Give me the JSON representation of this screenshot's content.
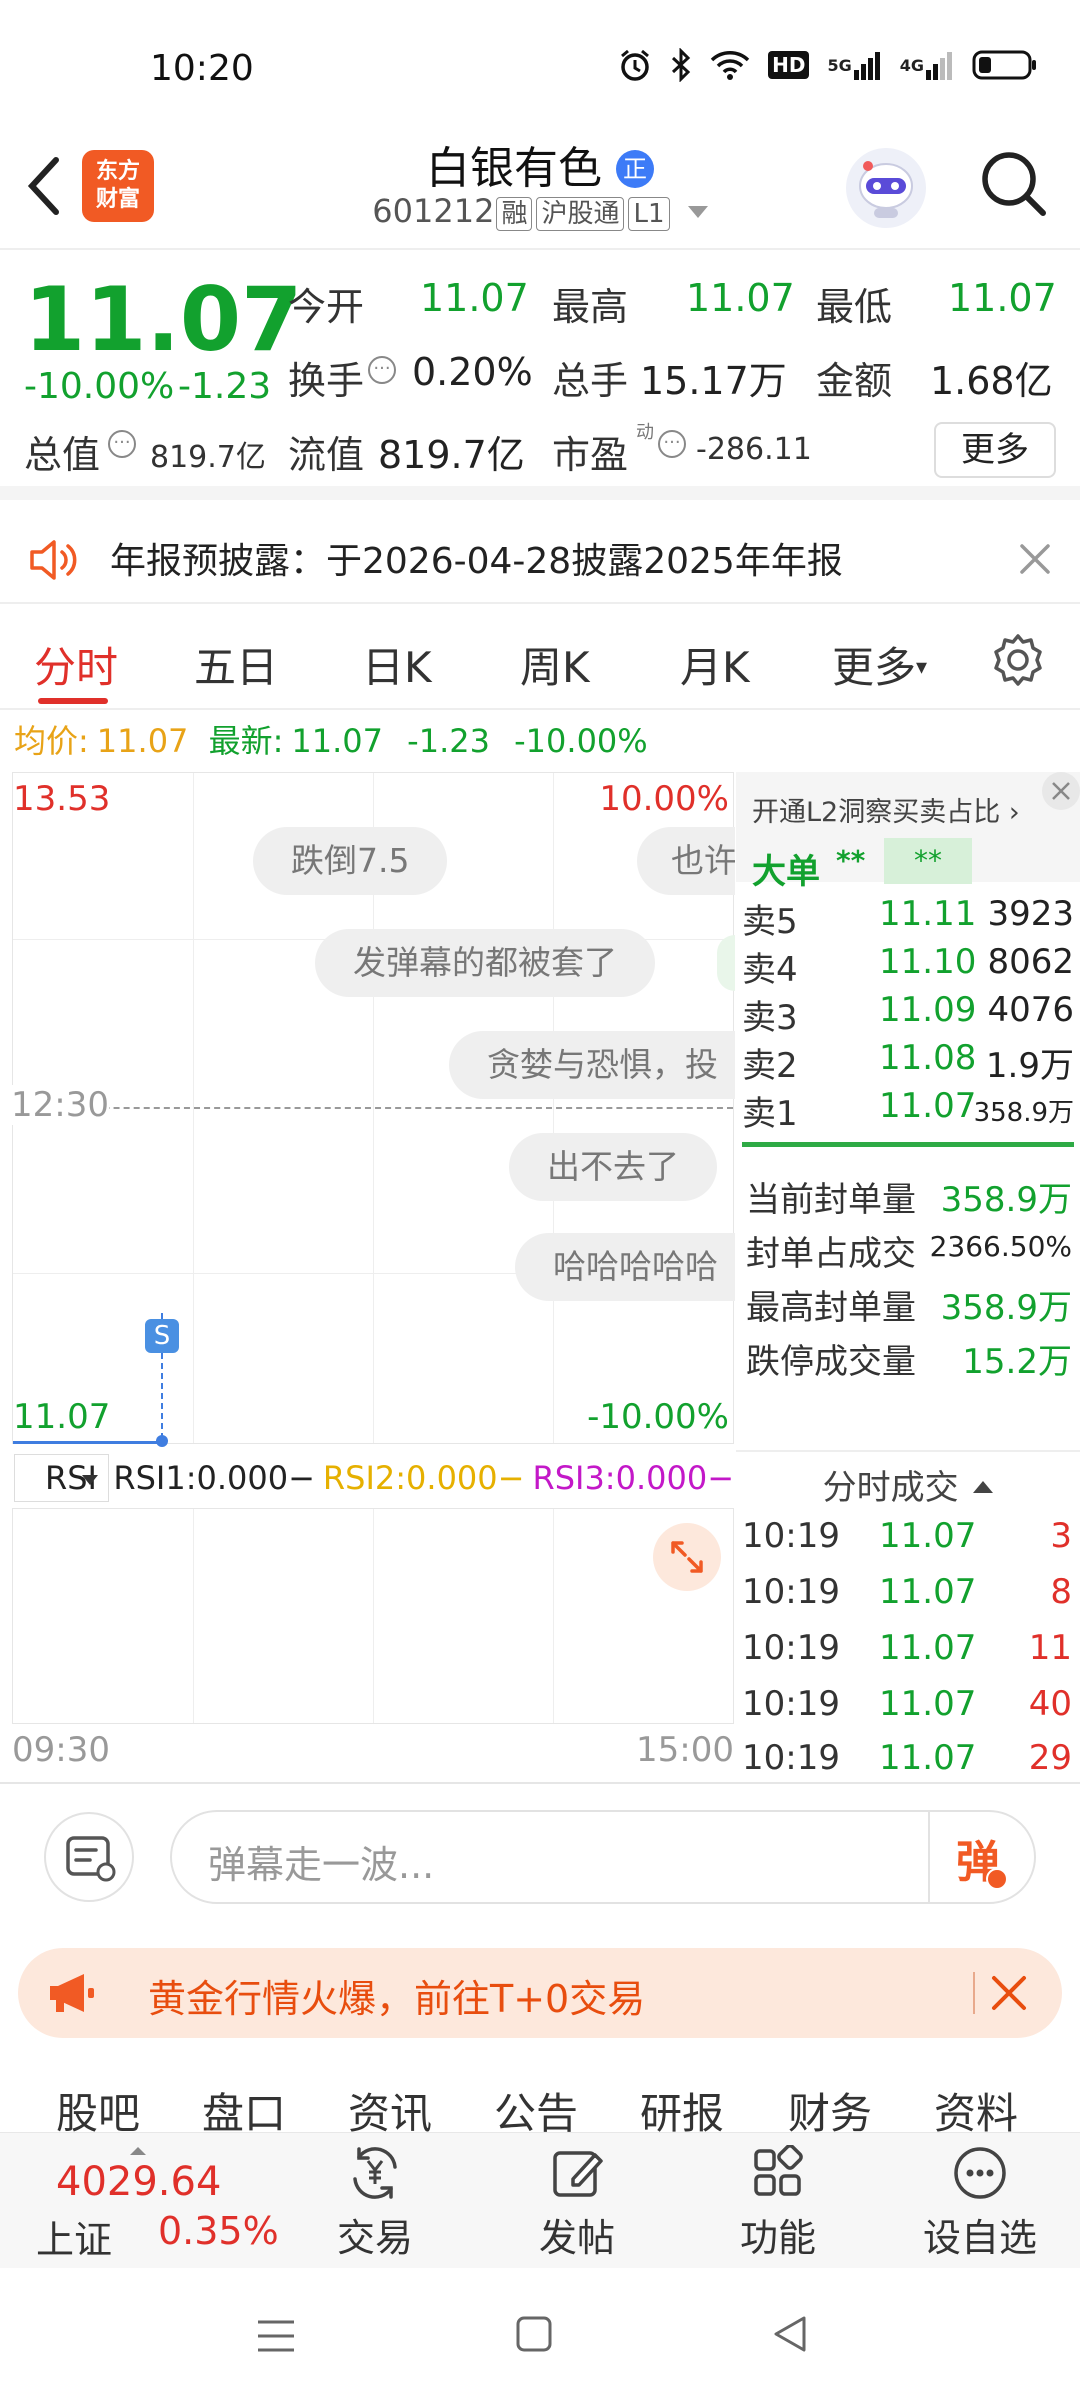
{
  "status_bar": {
    "time": "10:20",
    "net1": "5G",
    "net2": "4G",
    "hd": "HD"
  },
  "header": {
    "logo_text_1": "东方",
    "logo_text_2": "财富",
    "stock_name": "白银有色",
    "verify_badge": "正",
    "code": "601212",
    "tag_margin": "融",
    "tag_connect": "沪股通",
    "tag_level": "L1"
  },
  "quote": {
    "price": "11.07",
    "change_pct": "-10.00%",
    "change": "-1.23",
    "open_label": "今开",
    "open": "11.07",
    "high_label": "最高",
    "high": "11.07",
    "low_label": "最低",
    "low": "11.07",
    "turnover_label": "换手",
    "turnover": "0.20%",
    "volume_label": "总手",
    "volume": "15.17万",
    "amount_label": "金额",
    "amount": "1.68亿",
    "mktcap_label": "总值",
    "mktcap": "819.7亿",
    "float_label": "流值",
    "float": "819.7亿",
    "pe_label": "市盈",
    "pe_sup": "动",
    "pe": "-286.11",
    "more_button": "更多"
  },
  "notice": {
    "text": "年报预披露：于2026-04-28披露2025年年报"
  },
  "tabs": [
    {
      "label": "分时",
      "active": true
    },
    {
      "label": "五日"
    },
    {
      "label": "日K"
    },
    {
      "label": "周K"
    },
    {
      "label": "月K"
    },
    {
      "label": "更多"
    }
  ],
  "chart_info": {
    "avg_label": "均价:",
    "avg": "11.07",
    "latest_label": "最新:",
    "latest": "11.07",
    "change": "-1.23",
    "change_pct": "-10.00%"
  },
  "chart": {
    "y_top": "13.53",
    "pct_top": "10.00%",
    "y_bottom": "11.07",
    "pct_bottom": "-10.00%",
    "mid_time": "12:30",
    "marker": "S",
    "x_start": "09:30",
    "x_end": "15:00"
  },
  "danmu": [
    "跌倒7.5",
    "也许",
    "发弹幕的都被套了",
    "贪婪与恐惧，投",
    "出不去了",
    "哈哈哈哈哈"
  ],
  "rsi": {
    "select": "RSI",
    "rsi1": "RSI1:0.000",
    "rsi2": "RSI2:0.000",
    "rsi3": "RSI3:0.000"
  },
  "order_book": {
    "promo": "开通L2洞察买卖占比",
    "big_order_label": "大单",
    "big_order_val1": "**",
    "big_order_val2": "**",
    "asks": [
      {
        "label": "卖5",
        "price": "11.11",
        "vol": "3923"
      },
      {
        "label": "卖4",
        "price": "11.10",
        "vol": "8062"
      },
      {
        "label": "卖3",
        "price": "11.09",
        "vol": "4076"
      },
      {
        "label": "卖2",
        "price": "11.08",
        "vol": "1.9万"
      },
      {
        "label": "卖1",
        "price": "11.07",
        "vol": "358.9万"
      }
    ],
    "seal": [
      {
        "label": "当前封单量",
        "value": "358.9万"
      },
      {
        "label": "封单占成交",
        "value": "2366.50%"
      },
      {
        "label": "最高封单量",
        "value": "358.9万"
      },
      {
        "label": "跌停成交量",
        "value": "15.2万"
      }
    ],
    "ticks_title": "分时成交",
    "ticks": [
      {
        "time": "10:19",
        "price": "11.07",
        "vol": "3"
      },
      {
        "time": "10:19",
        "price": "11.07",
        "vol": "8"
      },
      {
        "time": "10:19",
        "price": "11.07",
        "vol": "11"
      },
      {
        "time": "10:19",
        "price": "11.07",
        "vol": "40"
      },
      {
        "time": "10:19",
        "price": "11.07",
        "vol": "29"
      }
    ]
  },
  "danmu_input": {
    "placeholder": "弹幕走一波...",
    "send": "弹"
  },
  "promo_bar": {
    "text": "黄金行情火爆，前往T+0交易"
  },
  "bottom_tabs": [
    "股吧",
    "盘口",
    "资讯",
    "公告",
    "研报",
    "财务",
    "资料"
  ],
  "index": {
    "value": "4029.64",
    "name": "上证",
    "change": "0.35%"
  },
  "nav": [
    {
      "label": "交易"
    },
    {
      "label": "发帖"
    },
    {
      "label": "功能"
    },
    {
      "label": "设自选"
    }
  ],
  "colors": {
    "up": "#e0302a",
    "down": "#12a12e",
    "accent": "#f15a24"
  }
}
